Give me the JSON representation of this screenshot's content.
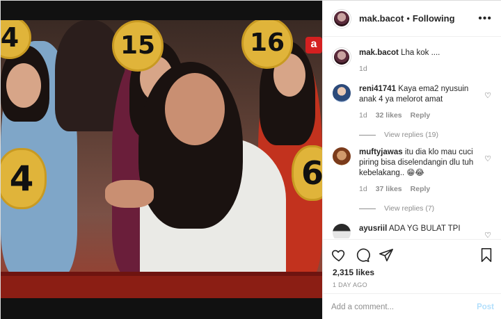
{
  "post": {
    "username": "mak.bacot",
    "follow_status": "Following",
    "caption_username": "mak.bacot",
    "caption_text": "Lha kok ....",
    "caption_age": "1d",
    "likes": "2,315 likes",
    "date": "1 DAY AGO"
  },
  "photo": {
    "numbers": [
      "4",
      "15",
      "16",
      "4",
      "6"
    ],
    "corner_badge": "a"
  },
  "comments": [
    {
      "username": "reni41741",
      "text": "Kaya ema2 nyusuin anak 4 ya melorot amat",
      "age": "1d",
      "likes": "32 likes",
      "reply": "Reply",
      "view_replies": "View replies (19)"
    },
    {
      "username": "muftyjawas",
      "text": "itu dia klo mau cuci piring bisa diselendangin dlu tuh kebelakang.. 😁😂",
      "age": "1d",
      "likes": "37 likes",
      "reply": "Reply",
      "view_replies": "View replies (7)"
    },
    {
      "username": "ayusriil",
      "text": "ADA YG BULAT TPI"
    }
  ],
  "add_comment": {
    "placeholder": "Add a comment...",
    "post_label": "Post"
  },
  "icons": {
    "more": "more-options-icon",
    "like": "heart-icon",
    "comment": "comment-icon",
    "share": "share-icon",
    "save": "bookmark-icon"
  }
}
